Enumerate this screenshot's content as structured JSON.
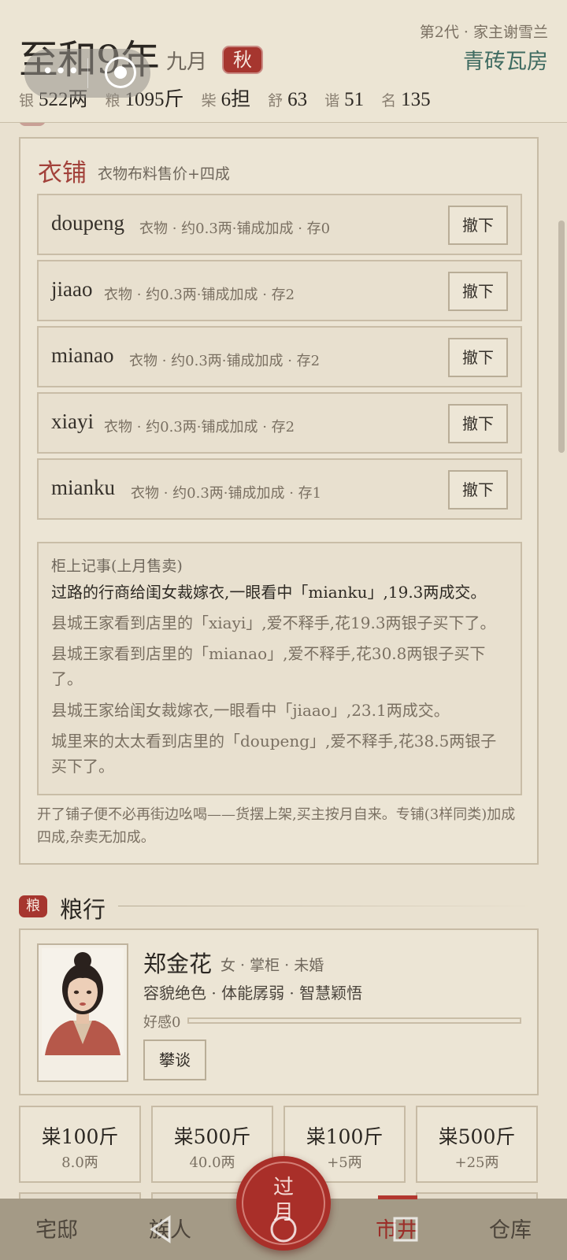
{
  "header": {
    "era": "至和9年",
    "month": "九月",
    "season": "秋",
    "generation": "第2代 · 家主谢雪兰",
    "residence": "青砖瓦房",
    "stats": [
      {
        "key": "银",
        "value": "522两"
      },
      {
        "key": "粮",
        "value": "1095斤"
      },
      {
        "key": "柴",
        "value": "6担"
      },
      {
        "key": "舒",
        "value": "63"
      },
      {
        "key": "谐",
        "value": "51"
      },
      {
        "key": "名",
        "value": "135"
      }
    ]
  },
  "shop": {
    "title": "衣铺",
    "desc": "衣物布料售价+四成",
    "remove_label": "撤下",
    "items": [
      {
        "name": "doupeng",
        "meta": "衣物 · 约0.3两·铺成加成 · 存0"
      },
      {
        "name": "jiaao",
        "meta": "衣物 · 约0.3两·铺成加成 · 存2"
      },
      {
        "name": "mianao",
        "meta": "衣物 · 约0.3两·铺成加成 · 存2"
      },
      {
        "name": "xiayi",
        "meta": "衣物 · 约0.3两·铺成加成 · 存2"
      },
      {
        "name": "mianku",
        "meta": "衣物 · 约0.3两·铺成加成 · 存1"
      }
    ],
    "ledger_title": "柜上记事(上月售卖)",
    "ledger": [
      "过路的行商给闺女裁嫁衣,一眼看中「mianku」,19.3两成交。",
      "县城王家看到店里的「xiayi」,爱不释手,花19.3两银子买下了。",
      "县城王家看到店里的「mianao」,爱不释手,花30.8两银子买下了。",
      "县城王家给闺女裁嫁衣,一眼看中「jiaao」,23.1两成交。",
      "城里来的太太看到店里的「doupeng」,爱不释手,花38.5两银子买下了。"
    ],
    "note": "开了铺子便不必再街边吆喝——货摆上架,买主按月自来。专铺(3样同类)加成四成,杂卖无加成。"
  },
  "grain": {
    "icon_text": "粮",
    "title": "粮行",
    "person": {
      "name": "郑金花",
      "meta": "女 · 掌柜 · 未婚",
      "traits": "容貌绝色 · 体能孱弱 · 智慧颖悟",
      "favor_label": "好感0",
      "favor_value": 0,
      "chat_label": "攀谈"
    },
    "trades": [
      {
        "label": "粜100斤",
        "sub": "8.0两"
      },
      {
        "label": "粜500斤",
        "sub": "40.0两"
      },
      {
        "label": "粜100斤",
        "sub": "+5两"
      },
      {
        "label": "粜500斤",
        "sub": "+25两"
      }
    ]
  },
  "nav": {
    "items": [
      "宅邸",
      "族人",
      "市井",
      "仓库"
    ],
    "active": "市井",
    "pass_label": "过月"
  },
  "colors": {
    "accent_red": "#a6362f",
    "background": "#e9e1d0",
    "residence_green": "#3f6b61"
  }
}
